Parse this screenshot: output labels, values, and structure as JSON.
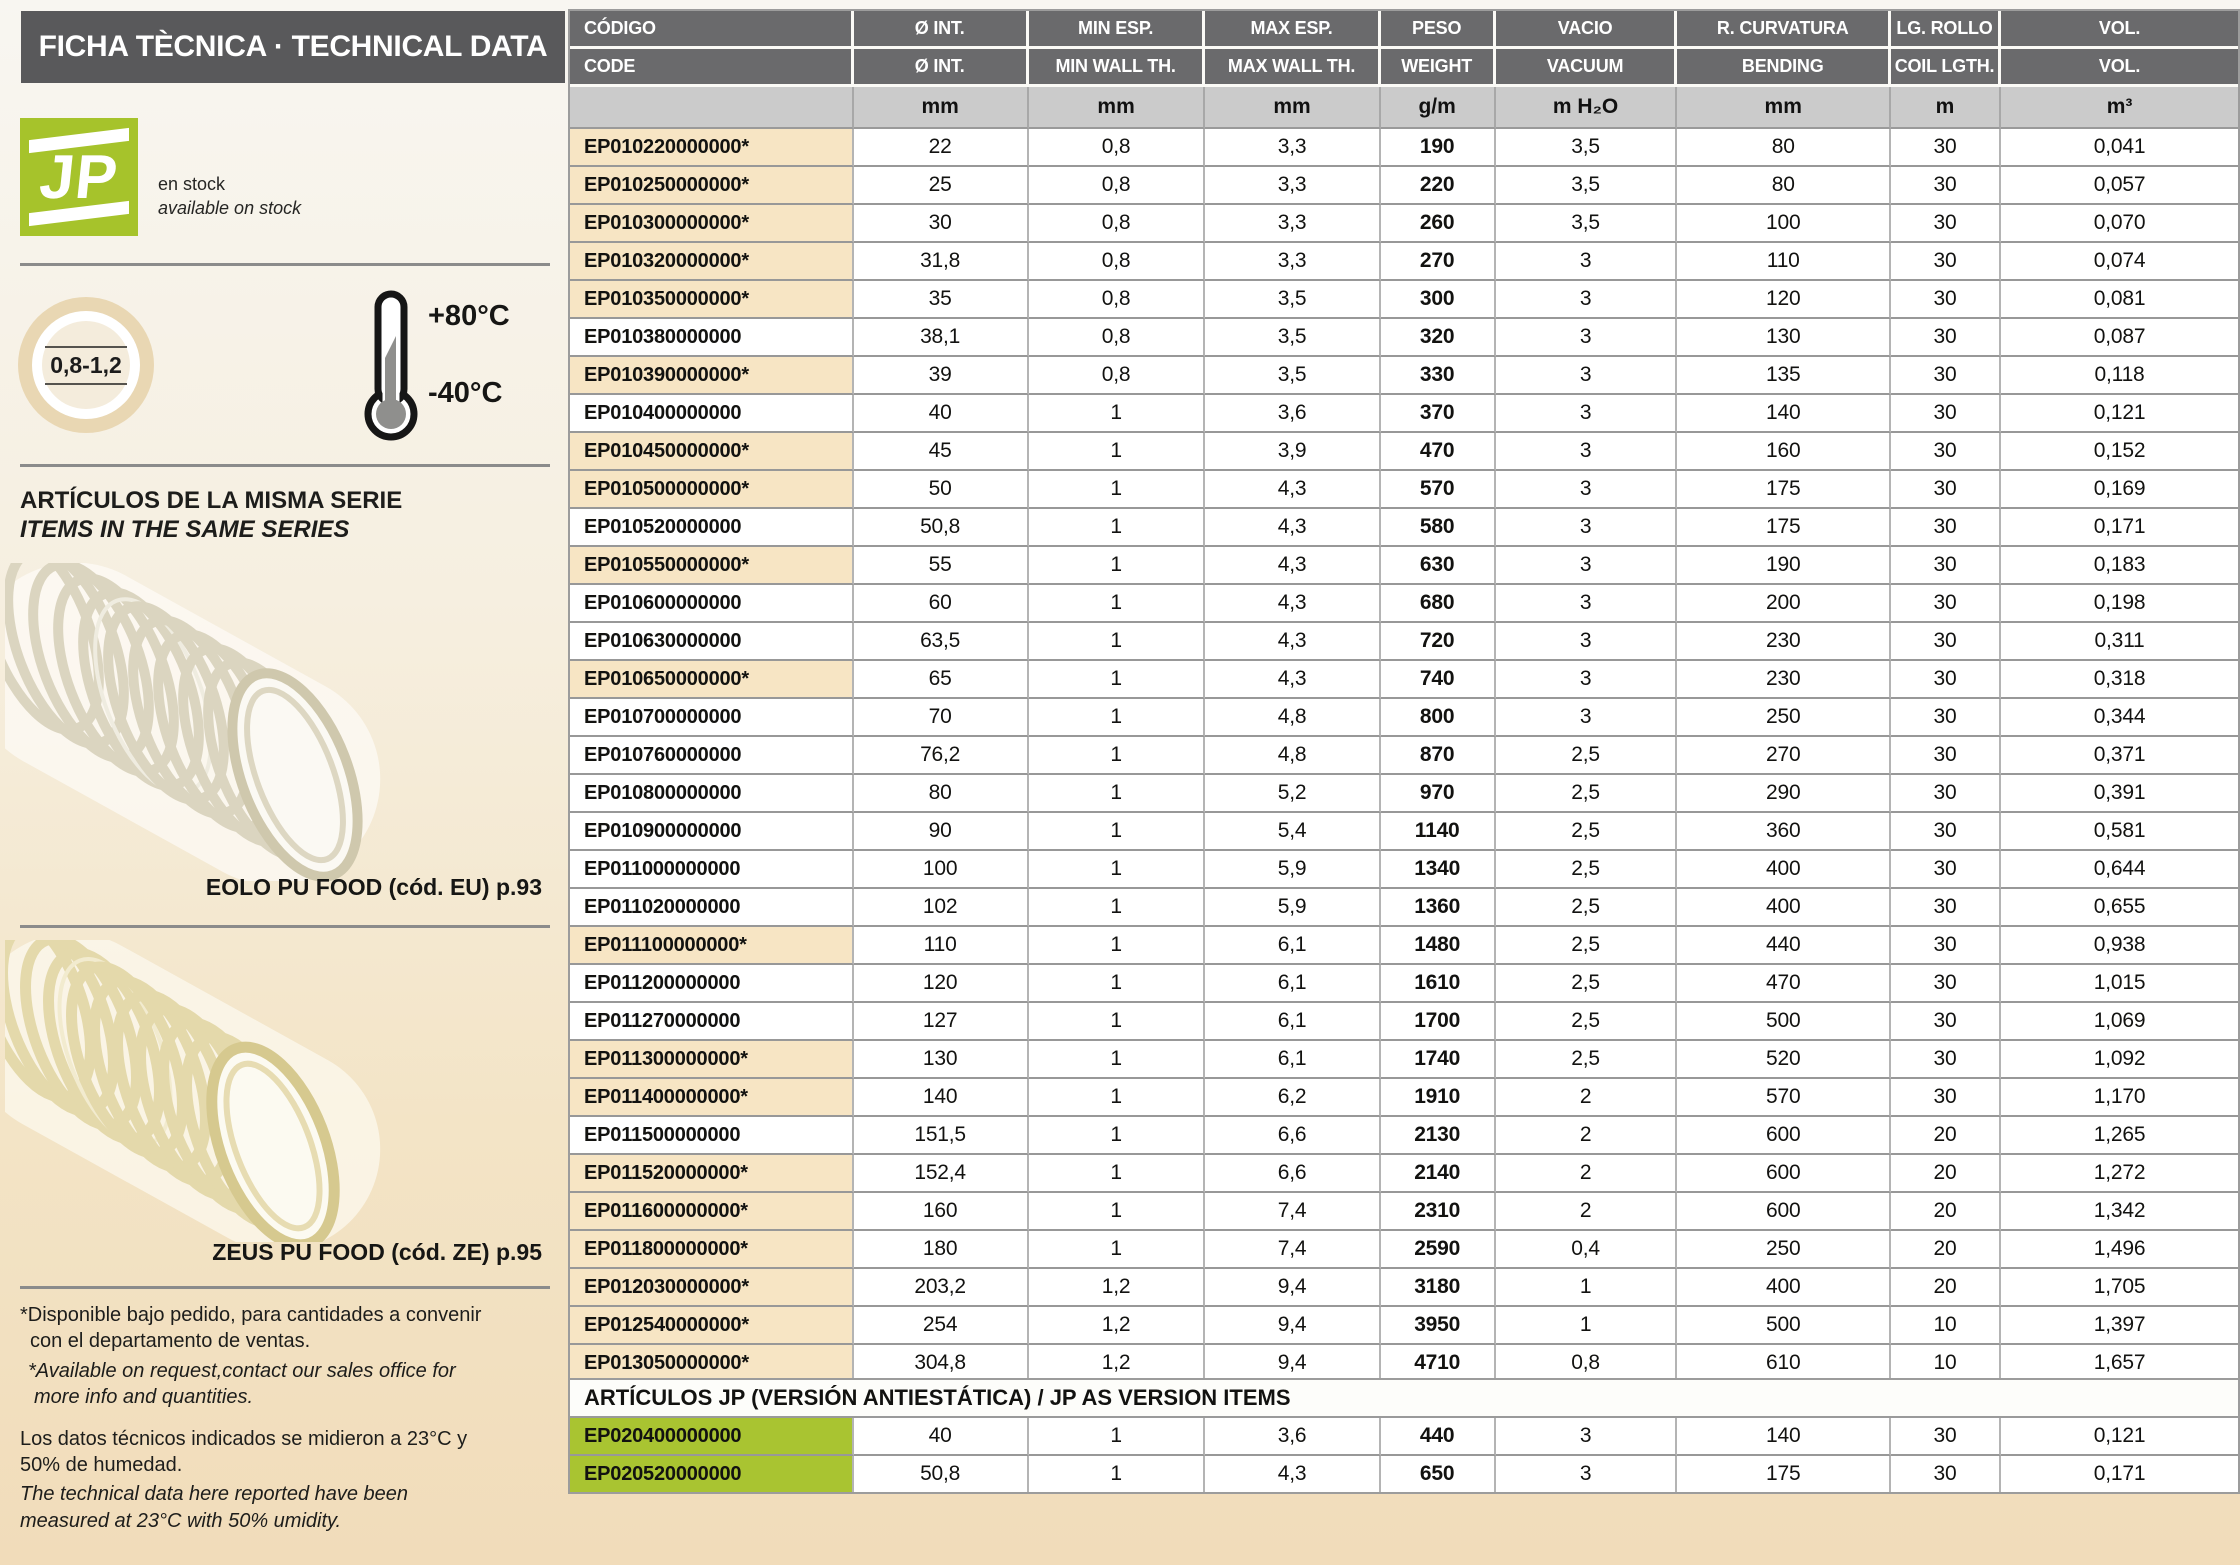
{
  "page": {
    "title_bar": "FICHA TÈCNICA · TECHNICAL DATA"
  },
  "sidebar": {
    "jp_logo_text": "JP",
    "stock": {
      "es": "en stock",
      "en": "available on stock"
    },
    "wall_thickness_range": "0,8-1,2",
    "temperature": {
      "max": "+80°C",
      "min": "-40°C"
    },
    "series_heading": {
      "es": "ARTÍCULOS DE LA MISMA SERIE",
      "en": "ITEMS IN THE SAME SERIES"
    },
    "related_items": [
      {
        "caption": "EOLO PU FOOD (cód. EU) p.93"
      },
      {
        "caption": "ZEUS PU FOOD (cód. ZE) p.95"
      }
    ],
    "footnote_pairs": [
      {
        "es": "*Disponible bajo pedido, para cantidades a convenir con el departamento de ventas.",
        "en": "*Available on request,contact our sales office for more info and quantities."
      },
      {
        "es": "Los datos técnicos indicados se midieron a 23°C y 50% de humedad.",
        "en": "The technical data here reported have been measured at 23°C with 50% umidity."
      }
    ]
  },
  "table": {
    "headers_row1": [
      "CÓDIGO",
      "Ø INT.",
      "MIN ESP.",
      "MAX ESP.",
      "PESO",
      "VACIO",
      "R. CURVATURA",
      "LG. ROLLO",
      "VOL."
    ],
    "headers_row2": [
      "CODE",
      "Ø INT.",
      "MIN WALL TH.",
      "MAX WALL TH.",
      "WEIGHT",
      "VACUUM",
      "BENDING",
      "COIL LGTH.",
      "VOL."
    ],
    "units": [
      "",
      "mm",
      "mm",
      "mm",
      "g/m",
      "m H₂O",
      "mm",
      "m",
      "m³"
    ],
    "rows": [
      {
        "code": "EP010220000000*",
        "highlight": true,
        "values": [
          "22",
          "0,8",
          "3,3",
          "190",
          "3,5",
          "80",
          "30",
          "0,041"
        ]
      },
      {
        "code": "EP010250000000*",
        "highlight": true,
        "values": [
          "25",
          "0,8",
          "3,3",
          "220",
          "3,5",
          "80",
          "30",
          "0,057"
        ]
      },
      {
        "code": "EP010300000000*",
        "highlight": true,
        "values": [
          "30",
          "0,8",
          "3,3",
          "260",
          "3,5",
          "100",
          "30",
          "0,070"
        ]
      },
      {
        "code": "EP010320000000*",
        "highlight": true,
        "values": [
          "31,8",
          "0,8",
          "3,3",
          "270",
          "3",
          "110",
          "30",
          "0,074"
        ]
      },
      {
        "code": "EP010350000000*",
        "highlight": true,
        "values": [
          "35",
          "0,8",
          "3,5",
          "300",
          "3",
          "120",
          "30",
          "0,081"
        ]
      },
      {
        "code": "EP010380000000",
        "highlight": false,
        "values": [
          "38,1",
          "0,8",
          "3,5",
          "320",
          "3",
          "130",
          "30",
          "0,087"
        ]
      },
      {
        "code": "EP010390000000*",
        "highlight": true,
        "values": [
          "39",
          "0,8",
          "3,5",
          "330",
          "3",
          "135",
          "30",
          "0,118"
        ]
      },
      {
        "code": "EP010400000000",
        "highlight": false,
        "values": [
          "40",
          "1",
          "3,6",
          "370",
          "3",
          "140",
          "30",
          "0,121"
        ]
      },
      {
        "code": "EP010450000000*",
        "highlight": true,
        "values": [
          "45",
          "1",
          "3,9",
          "470",
          "3",
          "160",
          "30",
          "0,152"
        ]
      },
      {
        "code": "EP010500000000*",
        "highlight": true,
        "values": [
          "50",
          "1",
          "4,3",
          "570",
          "3",
          "175",
          "30",
          "0,169"
        ]
      },
      {
        "code": "EP010520000000",
        "highlight": false,
        "values": [
          "50,8",
          "1",
          "4,3",
          "580",
          "3",
          "175",
          "30",
          "0,171"
        ]
      },
      {
        "code": "EP010550000000*",
        "highlight": true,
        "values": [
          "55",
          "1",
          "4,3",
          "630",
          "3",
          "190",
          "30",
          "0,183"
        ]
      },
      {
        "code": "EP010600000000",
        "highlight": false,
        "values": [
          "60",
          "1",
          "4,3",
          "680",
          "3",
          "200",
          "30",
          "0,198"
        ]
      },
      {
        "code": "EP010630000000",
        "highlight": false,
        "values": [
          "63,5",
          "1",
          "4,3",
          "720",
          "3",
          "230",
          "30",
          "0,311"
        ]
      },
      {
        "code": "EP010650000000*",
        "highlight": true,
        "values": [
          "65",
          "1",
          "4,3",
          "740",
          "3",
          "230",
          "30",
          "0,318"
        ]
      },
      {
        "code": "EP010700000000",
        "highlight": false,
        "values": [
          "70",
          "1",
          "4,8",
          "800",
          "3",
          "250",
          "30",
          "0,344"
        ]
      },
      {
        "code": "EP010760000000",
        "highlight": false,
        "values": [
          "76,2",
          "1",
          "4,8",
          "870",
          "2,5",
          "270",
          "30",
          "0,371"
        ]
      },
      {
        "code": "EP010800000000",
        "highlight": false,
        "values": [
          "80",
          "1",
          "5,2",
          "970",
          "2,5",
          "290",
          "30",
          "0,391"
        ]
      },
      {
        "code": "EP010900000000",
        "highlight": false,
        "values": [
          "90",
          "1",
          "5,4",
          "1140",
          "2,5",
          "360",
          "30",
          "0,581"
        ]
      },
      {
        "code": "EP011000000000",
        "highlight": false,
        "values": [
          "100",
          "1",
          "5,9",
          "1340",
          "2,5",
          "400",
          "30",
          "0,644"
        ]
      },
      {
        "code": "EP011020000000",
        "highlight": false,
        "values": [
          "102",
          "1",
          "5,9",
          "1360",
          "2,5",
          "400",
          "30",
          "0,655"
        ]
      },
      {
        "code": "EP011100000000*",
        "highlight": true,
        "values": [
          "110",
          "1",
          "6,1",
          "1480",
          "2,5",
          "440",
          "30",
          "0,938"
        ]
      },
      {
        "code": "EP011200000000",
        "highlight": false,
        "values": [
          "120",
          "1",
          "6,1",
          "1610",
          "2,5",
          "470",
          "30",
          "1,015"
        ]
      },
      {
        "code": "EP011270000000",
        "highlight": false,
        "values": [
          "127",
          "1",
          "6,1",
          "1700",
          "2,5",
          "500",
          "30",
          "1,069"
        ]
      },
      {
        "code": "EP011300000000*",
        "highlight": true,
        "values": [
          "130",
          "1",
          "6,1",
          "1740",
          "2,5",
          "520",
          "30",
          "1,092"
        ]
      },
      {
        "code": "EP011400000000*",
        "highlight": true,
        "values": [
          "140",
          "1",
          "6,2",
          "1910",
          "2",
          "570",
          "30",
          "1,170"
        ]
      },
      {
        "code": "EP011500000000",
        "highlight": false,
        "values": [
          "151,5",
          "1",
          "6,6",
          "2130",
          "2",
          "600",
          "20",
          "1,265"
        ]
      },
      {
        "code": "EP011520000000*",
        "highlight": true,
        "values": [
          "152,4",
          "1",
          "6,6",
          "2140",
          "2",
          "600",
          "20",
          "1,272"
        ]
      },
      {
        "code": "EP011600000000*",
        "highlight": true,
        "values": [
          "160",
          "1",
          "7,4",
          "2310",
          "2",
          "600",
          "20",
          "1,342"
        ]
      },
      {
        "code": "EP011800000000*",
        "highlight": true,
        "values": [
          "180",
          "1",
          "7,4",
          "2590",
          "0,4",
          "250",
          "20",
          "1,496"
        ]
      },
      {
        "code": "EP012030000000*",
        "highlight": true,
        "values": [
          "203,2",
          "1,2",
          "9,4",
          "3180",
          "1",
          "400",
          "20",
          "1,705"
        ]
      },
      {
        "code": "EP012540000000*",
        "highlight": true,
        "values": [
          "254",
          "1,2",
          "9,4",
          "3950",
          "1",
          "500",
          "10",
          "1,397"
        ]
      },
      {
        "code": "EP013050000000*",
        "highlight": true,
        "values": [
          "304,8",
          "1,2",
          "9,4",
          "4710",
          "0,8",
          "610",
          "10",
          "1,657"
        ]
      }
    ]
  },
  "as_table": {
    "title": "ARTÍCULOS JP (VERSIÓN ANTIESTÁTICA) / JP AS VERSION ITEMS",
    "rows": [
      {
        "code": "EP020400000000",
        "values": [
          "40",
          "1",
          "3,6",
          "440",
          "3",
          "140",
          "30",
          "0,121"
        ]
      },
      {
        "code": "EP020520000000",
        "values": [
          "50,8",
          "1",
          "4,3",
          "650",
          "3",
          "175",
          "30",
          "0,171"
        ]
      }
    ]
  },
  "colors": {
    "accent_green": "#a6c32b",
    "as_row_green": "#a9c431",
    "highlight_beige": "#f7e5c4",
    "header_gray": "#6a6a6c",
    "units_gray": "#cbcbcb",
    "title_bar_gray": "#59595b"
  }
}
